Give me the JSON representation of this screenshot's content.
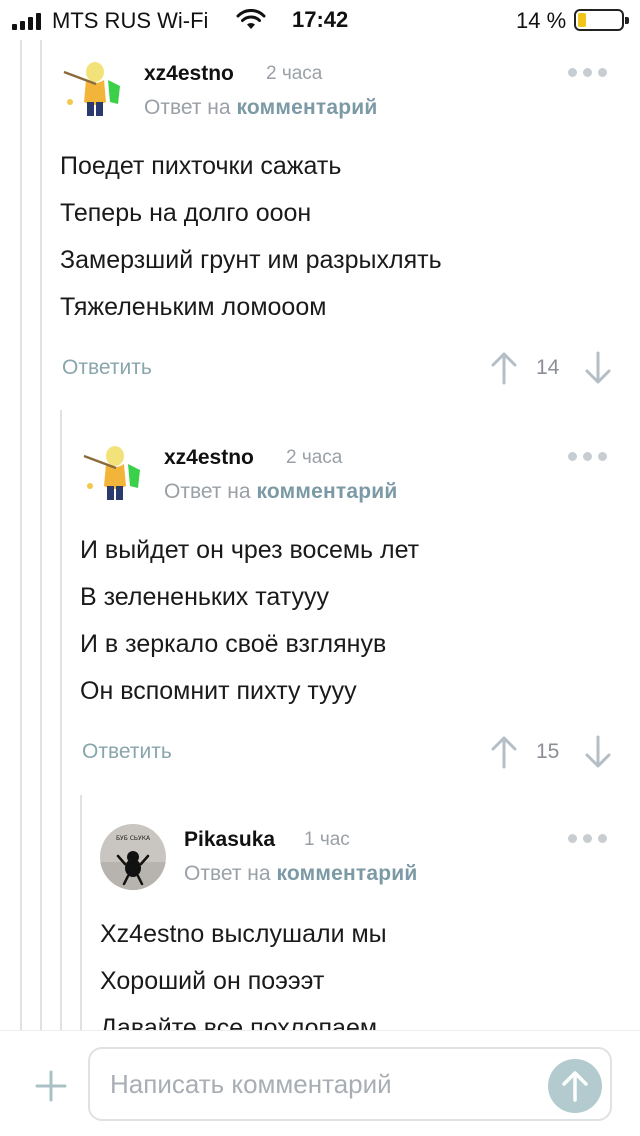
{
  "status_bar": {
    "carrier": "MTS RUS Wi-Fi",
    "time": "17:42",
    "battery": "14 %"
  },
  "comments": [
    {
      "author": "xz4estno",
      "time": "2 часа",
      "reply_prefix": "Ответ на",
      "reply_link": "комментарий",
      "lines": [
        "Поедет пихточки сажать",
        "Теперь на долго ооон",
        "Замерзший грунт им разрыхлять",
        "Тяжеленьким ломооом"
      ],
      "reply_label": "Ответить",
      "score": "14"
    },
    {
      "author": "xz4estno",
      "time": "2 часа",
      "reply_prefix": "Ответ на",
      "reply_link": "комментарий",
      "lines": [
        "И выйдет он чрез восемь лет",
        "В зелененьких татууу",
        "И в зеркало своё взглянув",
        "Он вспомнит пихту тууу"
      ],
      "reply_label": "Ответить",
      "score": "15"
    },
    {
      "author": "Pikasuka",
      "time": "1 час",
      "reply_prefix": "Ответ на",
      "reply_link": "комментарий",
      "avatar_text": "БУБ СЬУКА",
      "lines": [
        "Xz4estno выслушали мы",
        "Хороший он поэээт",
        "Давайте все похлопаем"
      ]
    }
  ],
  "composer": {
    "placeholder": "Написать комментарий"
  },
  "colors": {
    "accent": "#7c9aa5",
    "muted": "#9aa0a6",
    "send": "#b3cbcf"
  }
}
